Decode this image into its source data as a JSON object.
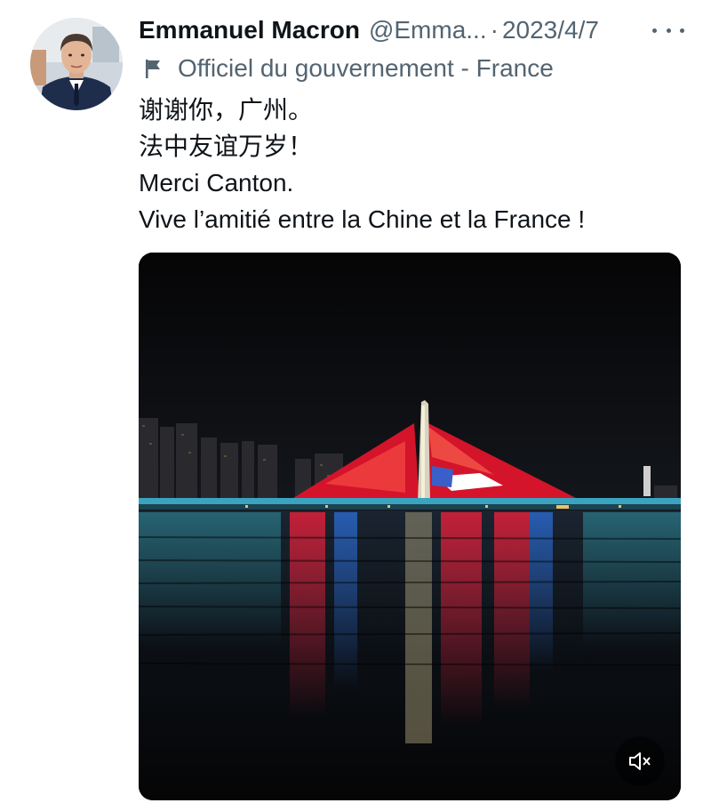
{
  "tweet": {
    "author_name": "Emmanuel Macron",
    "handle": "@Emma...",
    "separator": "·",
    "date": "2023/4/7",
    "label": "Officiel du gouvernement - France",
    "text_lines": [
      "谢谢你，广州。",
      "法中友谊万岁！",
      "Merci Canton.",
      "Vive l’amitié entre la Chine et la France !"
    ]
  },
  "icons": {
    "more": "more-horizontal-icon",
    "label": "flag-icon",
    "media_control": "speaker-muted-icon"
  },
  "colors": {
    "text_primary": "#0f1419",
    "text_secondary": "#536471",
    "media_background": "#050506"
  }
}
